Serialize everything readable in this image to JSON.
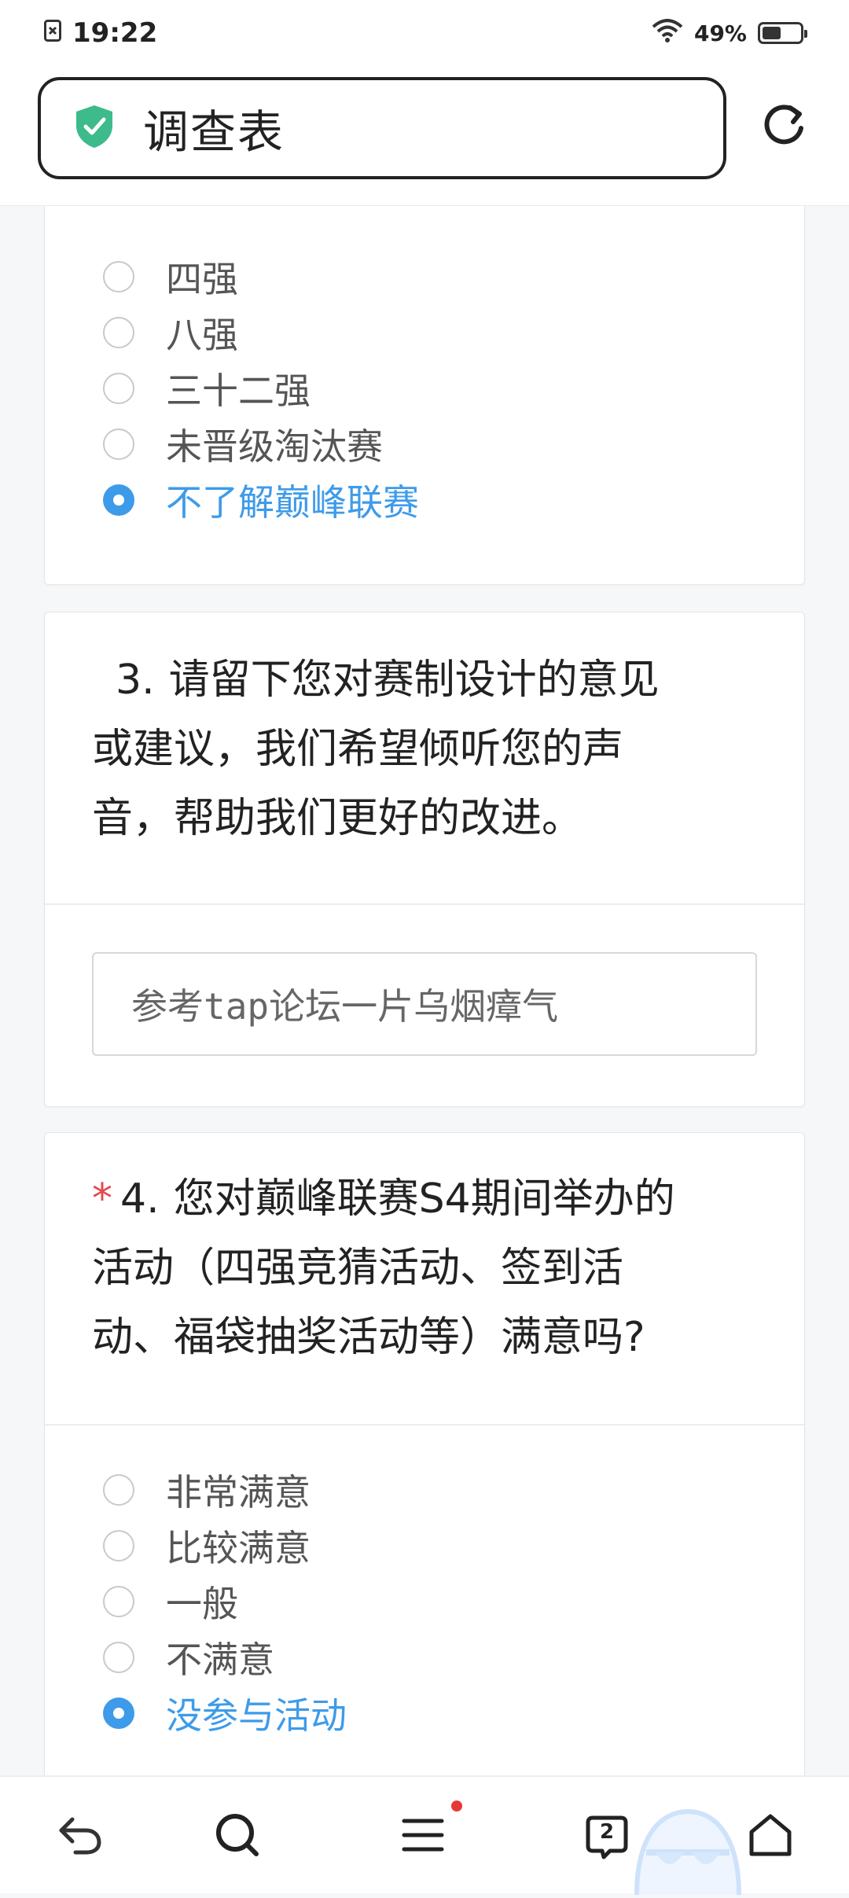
{
  "status_bar": {
    "time": "19:22",
    "battery_text": "49%",
    "battery_level": 0.49
  },
  "header": {
    "page_title": "调查表",
    "secure_icon_color": "#3dbb8a"
  },
  "q2_options": [
    {
      "label": "四强",
      "selected": false
    },
    {
      "label": "八强",
      "selected": false
    },
    {
      "label": "三十二强",
      "selected": false
    },
    {
      "label": "未晋级淘汰赛",
      "selected": false
    },
    {
      "label": "不了解巅峰联赛",
      "selected": true
    }
  ],
  "q3": {
    "number": "3.",
    "line1": "请留下您对赛制设计的意见",
    "line2": "或建议，我们希望倾听您的声",
    "line3": "音，帮助我们更好的改进。",
    "answer": "参考tap论坛一片乌烟瘴气"
  },
  "q4": {
    "required_mark": "*",
    "number": "4.",
    "line1": "您对巅峰联赛S4期间举办的",
    "line2": "活动（四强竞猜活动、签到活",
    "line3": "动、福袋抽奖活动等）满意吗?",
    "options": [
      {
        "label": "非常满意",
        "selected": false
      },
      {
        "label": "比较满意",
        "selected": false
      },
      {
        "label": "一般",
        "selected": false
      },
      {
        "label": "不满意",
        "selected": false
      },
      {
        "label": "没参与活动",
        "selected": true
      }
    ]
  },
  "bottom_nav": {
    "tabs_count": "2"
  },
  "colors": {
    "accent": "#3e9be9",
    "required": "#e5484d"
  }
}
